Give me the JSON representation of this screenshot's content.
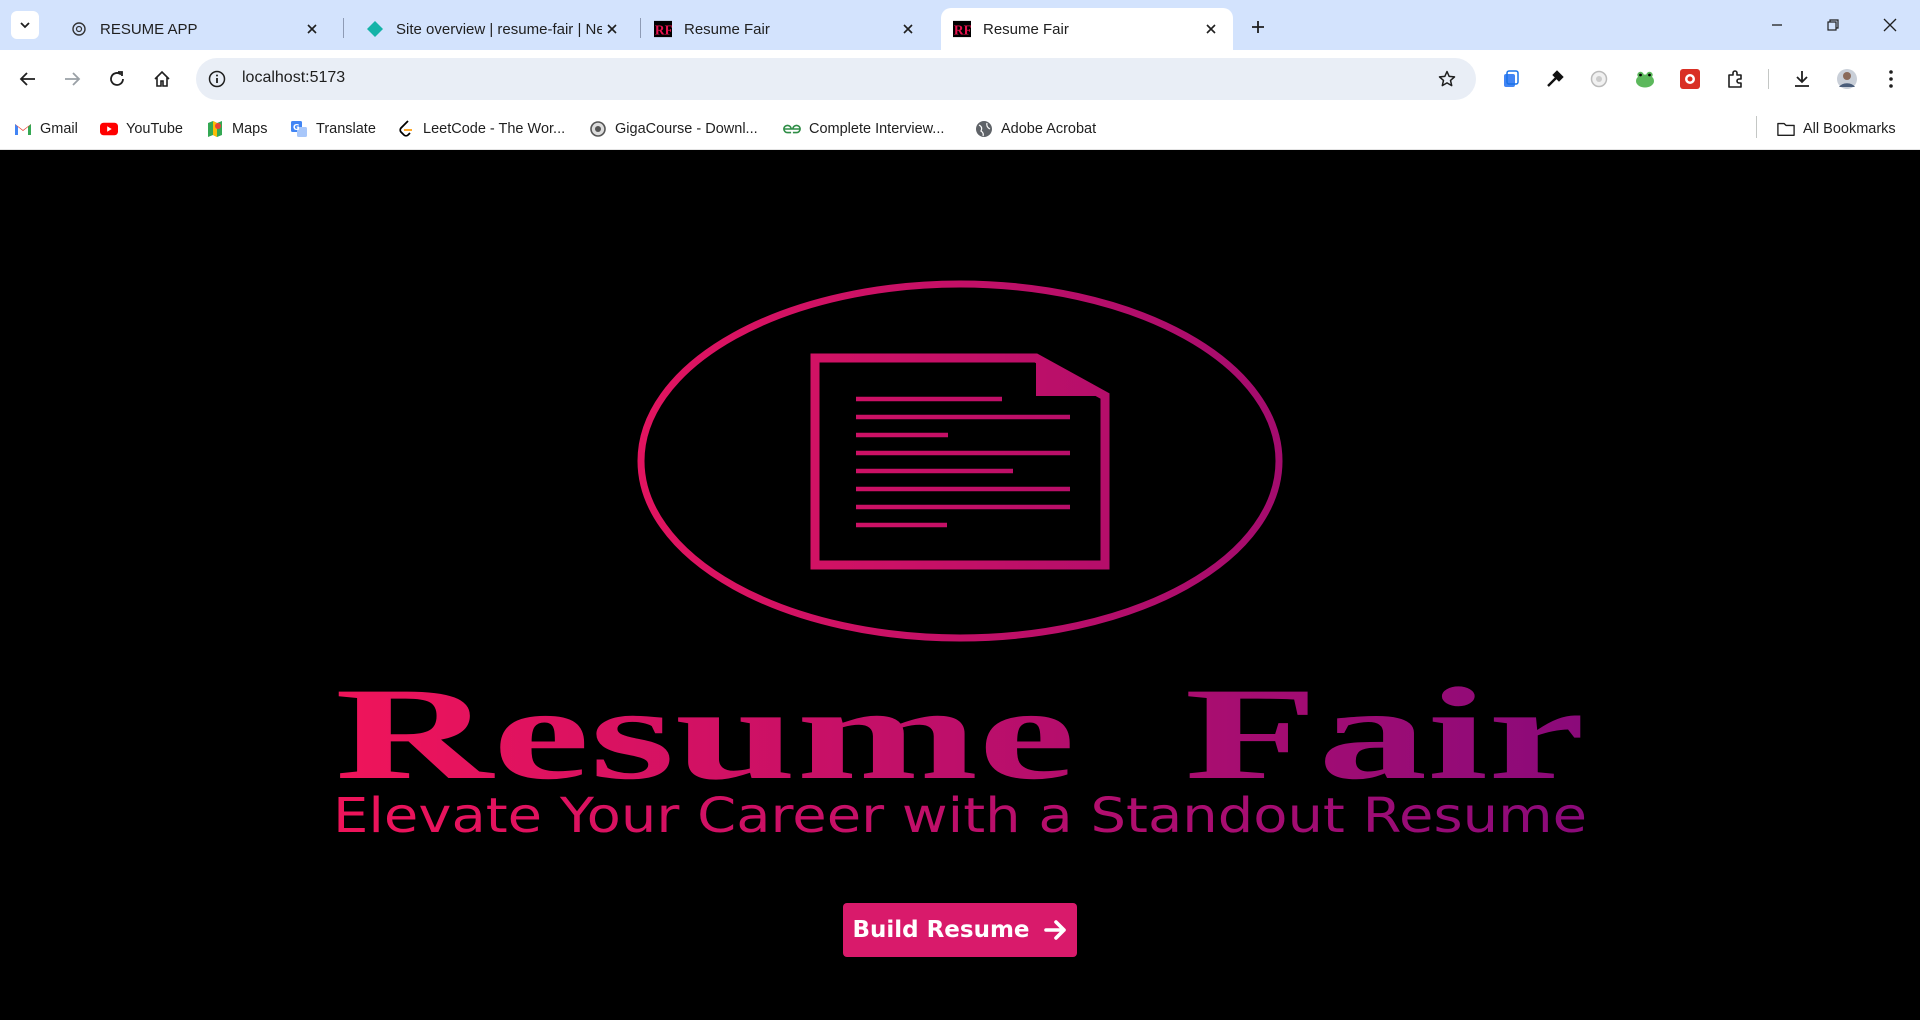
{
  "browser": {
    "tabs": [
      {
        "title": "RESUME APP",
        "icon": "openai-icon",
        "active": false
      },
      {
        "title": "Site overview | resume-fair | Net",
        "icon": "netlify-icon",
        "active": false
      },
      {
        "title": "Resume Fair",
        "icon": "rf-logo-icon",
        "active": false
      },
      {
        "title": "Resume Fair",
        "icon": "rf-logo-icon",
        "active": true
      }
    ],
    "url": "localhost:5173",
    "favicon_text": "RF",
    "bookmarks": [
      {
        "label": "Gmail",
        "icon": "gmail-icon"
      },
      {
        "label": "YouTube",
        "icon": "youtube-icon"
      },
      {
        "label": "Maps",
        "icon": "maps-icon"
      },
      {
        "label": "Translate",
        "icon": "translate-icon"
      },
      {
        "label": "LeetCode - The Wor...",
        "icon": "leetcode-icon"
      },
      {
        "label": "GigaCourse - Downl...",
        "icon": "gigacourse-icon"
      },
      {
        "label": "Complete Interview...",
        "icon": "gfg-icon"
      },
      {
        "label": "Adobe Acrobat",
        "icon": "globe-icon"
      }
    ],
    "all_bookmarks_label": "All Bookmarks"
  },
  "hero": {
    "title": "Resume  Fair",
    "tagline": "Elevate Your Career with a Standout Resume",
    "cta_label": "Build Resume",
    "colors": {
      "gradient_start": "#f0145a",
      "gradient_end": "#8a0a7a",
      "button": "#d91a6b"
    }
  }
}
